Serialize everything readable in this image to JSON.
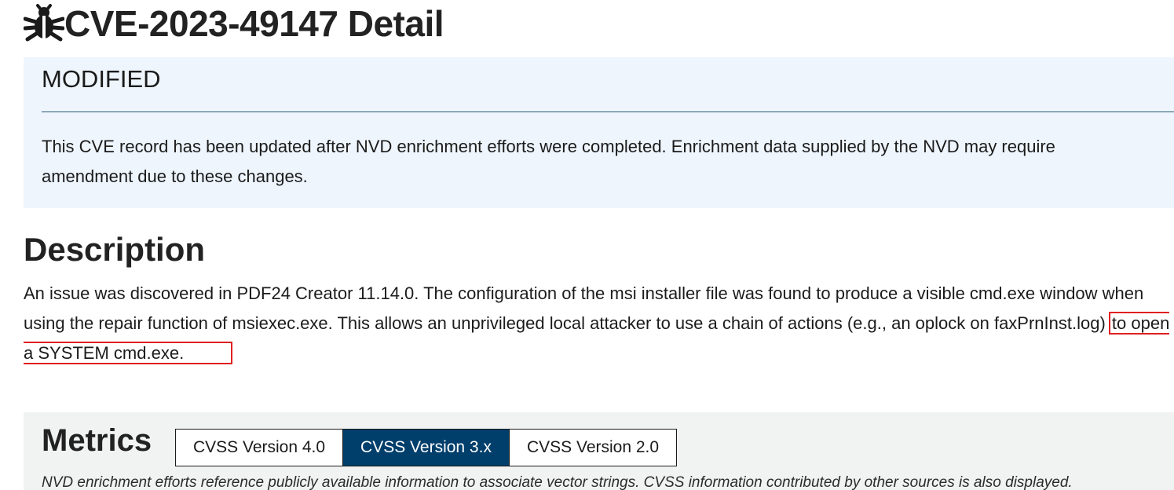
{
  "header": {
    "title": "CVE-2023-49147 Detail",
    "icon": "bug-icon"
  },
  "modified_notice": {
    "heading": "MODIFIED",
    "text": "This CVE record has been updated after NVD enrichment efforts were completed. Enrichment data supplied by the NVD may require amendment due to these changes."
  },
  "description": {
    "heading": "Description",
    "text_main": "An issue was discovered in PDF24 Creator 11.14.0. The configuration of the msi installer file was found to produce a visible cmd.exe window when using the repair function of msiexec.exe. This allows an unprivileged local attacker to use a chain of actions (e.g., an oplock on faxPrnInst.log)",
    "text_highlighted": "to open a SYSTEM cmd.exe.",
    "highlight_color": "#e02020"
  },
  "metrics": {
    "heading": "Metrics",
    "tabs": [
      {
        "label": "CVSS Version 4.0",
        "active": false
      },
      {
        "label": "CVSS Version 3.x",
        "active": true
      },
      {
        "label": "CVSS Version 2.0",
        "active": false
      }
    ],
    "note": "NVD enrichment efforts reference publicly available information to associate vector strings. CVSS information contributed by other sources is also displayed."
  },
  "colors": {
    "notice_bg": "#eef5fc",
    "metrics_bg": "#f1f3f2",
    "active_tab_bg": "#003e6b"
  }
}
